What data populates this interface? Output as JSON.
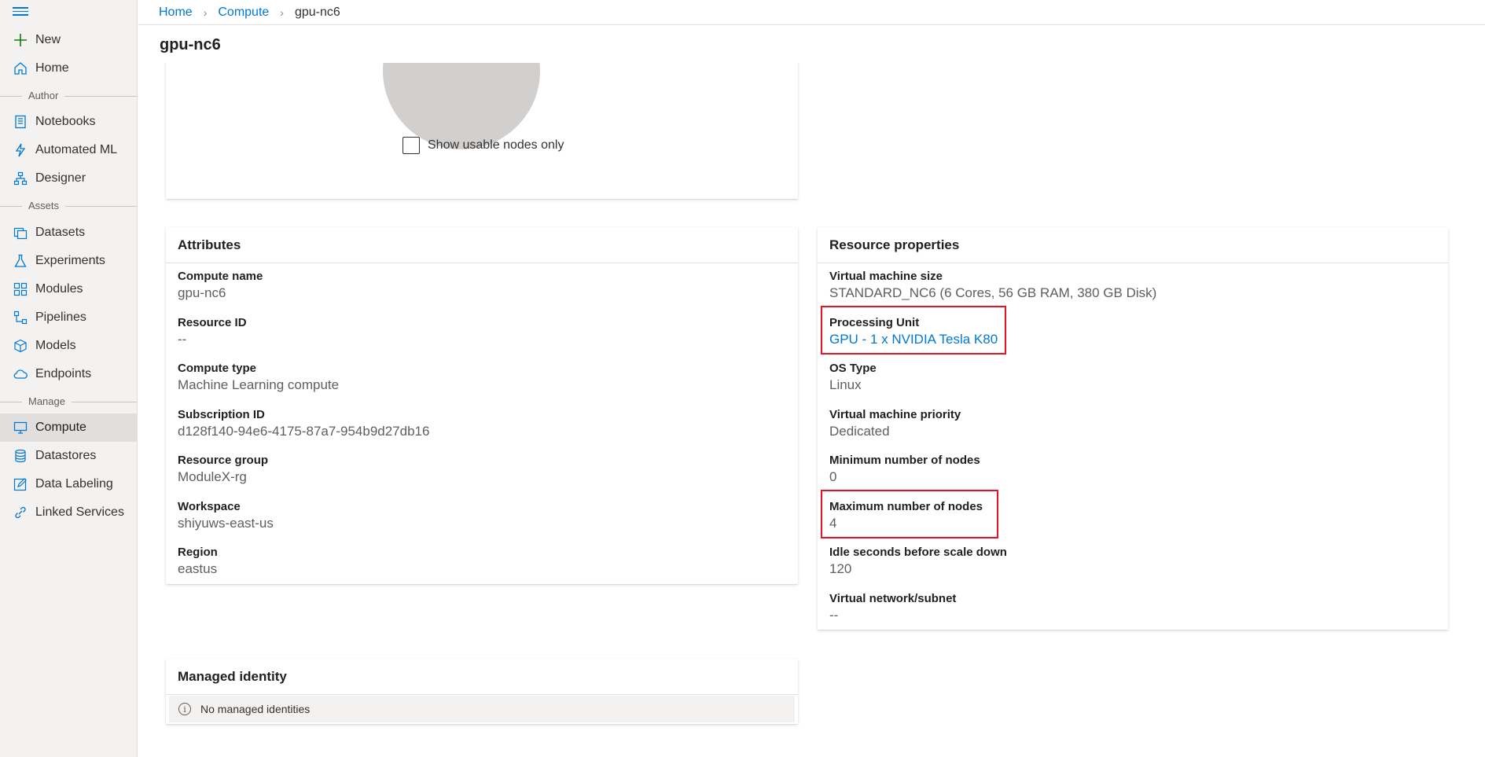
{
  "sidebar": {
    "items": [
      {
        "label": "New",
        "icon": "plus-icon"
      },
      {
        "label": "Home",
        "icon": "home-icon"
      },
      {
        "label": "Notebooks",
        "icon": "notebook-icon"
      },
      {
        "label": "Automated ML",
        "icon": "automl-icon"
      },
      {
        "label": "Designer",
        "icon": "designer-icon"
      },
      {
        "label": "Datasets",
        "icon": "datasets-icon"
      },
      {
        "label": "Experiments",
        "icon": "flask-icon"
      },
      {
        "label": "Modules",
        "icon": "modules-icon"
      },
      {
        "label": "Pipelines",
        "icon": "pipelines-icon"
      },
      {
        "label": "Models",
        "icon": "cube-icon"
      },
      {
        "label": "Endpoints",
        "icon": "cloud-icon"
      },
      {
        "label": "Compute",
        "icon": "monitor-icon"
      },
      {
        "label": "Datastores",
        "icon": "database-icon"
      },
      {
        "label": "Data Labeling",
        "icon": "edit-icon"
      },
      {
        "label": "Linked Services",
        "icon": "link-icon"
      }
    ],
    "sections": {
      "author": "Author",
      "assets": "Assets",
      "manage": "Manage"
    }
  },
  "breadcrumb": {
    "home": "Home",
    "compute": "Compute",
    "current": "gpu-nc6"
  },
  "page_title": "gpu-nc6",
  "nodes_card": {
    "checkbox_label": "Show usable nodes only"
  },
  "attributes": {
    "title": "Attributes",
    "fields": [
      {
        "key": "Compute name",
        "value": "gpu-nc6"
      },
      {
        "key": "Resource ID",
        "value": "--"
      },
      {
        "key": "Compute type",
        "value": "Machine Learning compute"
      },
      {
        "key": "Subscription ID",
        "value": "d128f140-94e6-4175-87a7-954b9d27db16"
      },
      {
        "key": "Resource group",
        "value": "ModuleX-rg"
      },
      {
        "key": "Workspace",
        "value": "shiyuws-east-us"
      },
      {
        "key": "Region",
        "value": "eastus"
      }
    ]
  },
  "resource_properties": {
    "title": "Resource properties",
    "fields": [
      {
        "key": "Virtual machine size",
        "value": "STANDARD_NC6 (6 Cores, 56 GB RAM, 380 GB Disk)"
      },
      {
        "key": "Processing Unit",
        "value": "GPU - 1 x NVIDIA Tesla K80"
      },
      {
        "key": "OS Type",
        "value": "Linux"
      },
      {
        "key": "Virtual machine priority",
        "value": "Dedicated"
      },
      {
        "key": "Minimum number of nodes",
        "value": "0"
      },
      {
        "key": "Maximum number of nodes",
        "value": "4"
      },
      {
        "key": "Idle seconds before scale down",
        "value": "120"
      },
      {
        "key": "Virtual network/subnet",
        "value": "--"
      }
    ]
  },
  "managed_identity": {
    "title": "Managed identity",
    "info": "No managed identities"
  },
  "colors": {
    "accent": "#0078d4",
    "highlight": "#e81123",
    "sidebar_bg": "#f3f2f1"
  }
}
